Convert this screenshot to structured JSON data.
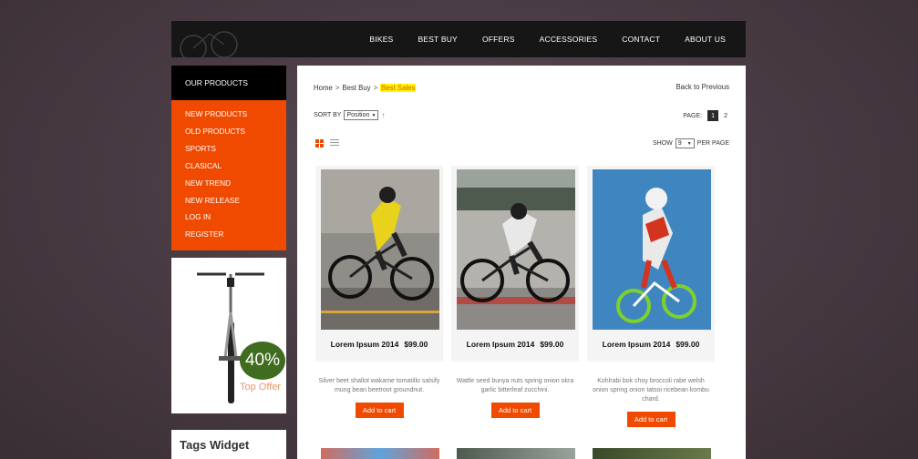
{
  "nav": [
    "BIKES",
    "BEST BUY",
    "OFFERS",
    "ACCESSORIES",
    "CONTACT",
    "ABOUT US"
  ],
  "sidebar": {
    "heading": "OUR PRODUCTS",
    "items": [
      "NEW PRODUCTS",
      "OLD PRODUCTS",
      "SPORTS",
      "CLASICAL",
      "NEW TREND",
      "NEW RELEASE",
      "LOG IN",
      "REGISTER"
    ]
  },
  "offer": {
    "percent": "40%",
    "label": "Top Offer"
  },
  "tags": {
    "title": "Tags Widget"
  },
  "breadcrumb": {
    "home": "Home",
    "section": "Best Buy",
    "current": "Best Sales",
    "separator": ">"
  },
  "back_link": "Back to Previous",
  "sort": {
    "label": "SORT BY",
    "value": "Position",
    "arrow": "↑"
  },
  "pager": {
    "label": "PAGE:",
    "current": "1",
    "next": "2"
  },
  "show": {
    "label": "SHOW",
    "value": "9",
    "suffix": "PER PAGE"
  },
  "products": [
    {
      "name": "Lorem Ipsum 2014",
      "price": "$99.00",
      "desc": "Silver beet shallot wakame tomatillo salsify mung bean beetroot groundnut.",
      "cta": "Add to cart"
    },
    {
      "name": "Lorem Ipsum 2014",
      "price": "$99.00",
      "desc": "Wattle seed bunya nuts spring onion okra garlic bitterleaf zucchini.",
      "cta": "Add to cart"
    },
    {
      "name": "Lorem Ipsum 2014",
      "price": "$99.00",
      "desc": "Kohlrabi bok choy broccoli rabe welsh onion spring onion tatsoi ricebean kombu chard.",
      "cta": "Add to cart"
    }
  ],
  "colors": {
    "accent": "#f04a00",
    "header": "#161616",
    "highlight": "#fff600"
  }
}
